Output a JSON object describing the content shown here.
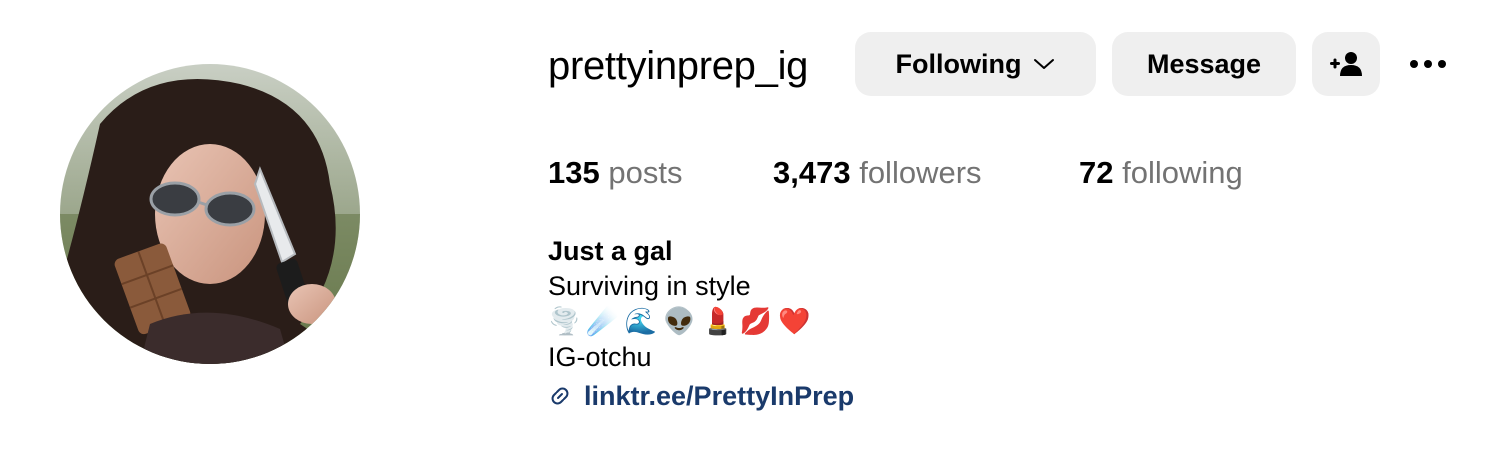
{
  "profile": {
    "username": "prettyinprep_ig",
    "avatar_alt": "profile picture"
  },
  "actions": {
    "following_label": "Following",
    "message_label": "Message",
    "add_user_icon": "person-add-icon",
    "more_icon": "more-horizontal-icon"
  },
  "stats": {
    "posts_count": "135",
    "posts_label": "posts",
    "followers_count": "3,473",
    "followers_label": "followers",
    "following_count": "72",
    "following_label": "following"
  },
  "bio": {
    "name": "Just a gal",
    "line1": "Surviving in style",
    "emojis": [
      "🌪️",
      "☄️",
      "🌊",
      "👽",
      "💄",
      "💋",
      "❤️"
    ],
    "line2": "IG-otchu",
    "link_icon": "link-icon",
    "link_text": "linktr.ee/PrettyInPrep"
  },
  "colors": {
    "button_bg": "#efefef",
    "muted_text": "#737373",
    "link": "#1a3a6b"
  }
}
